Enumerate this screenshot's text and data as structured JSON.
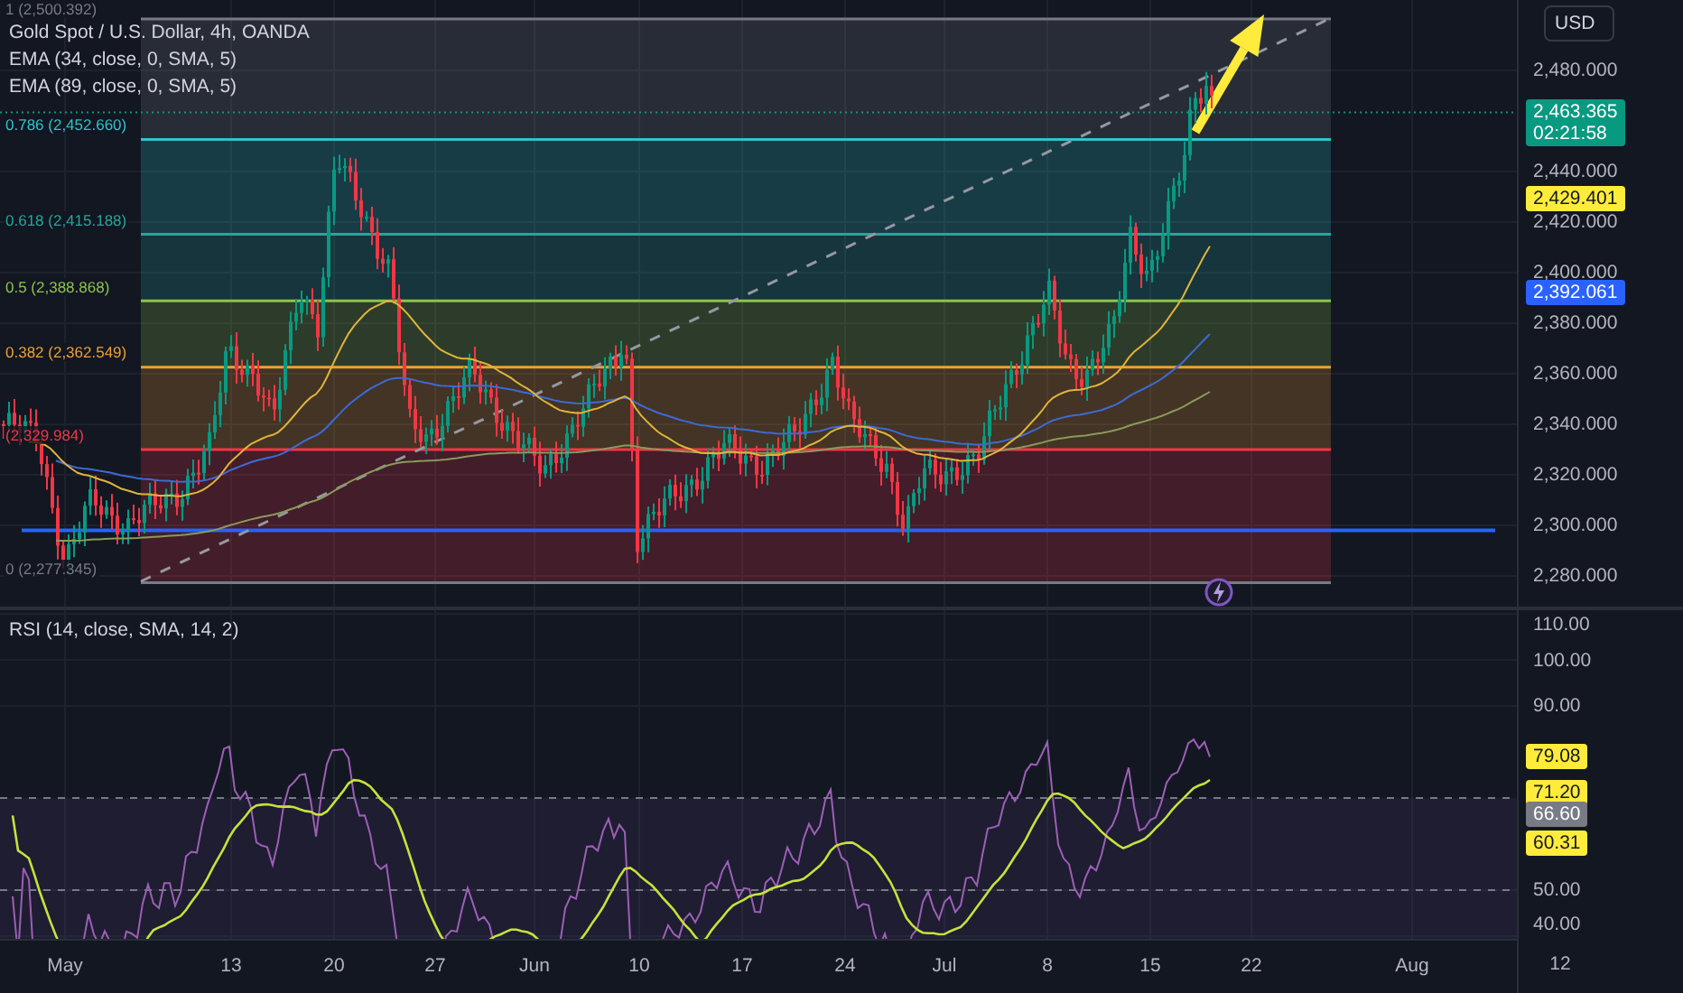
{
  "legend": {
    "title": "Gold Spot / U.S. Dollar, 4h, OANDA",
    "indicators": [
      "EMA (34, close, 0, SMA, 5)",
      "EMA (89, close, 0, SMA, 5)"
    ]
  },
  "currency_button": "USD",
  "fib_levels": [
    {
      "label": "1 (2,500.392)",
      "color": "#787b86"
    },
    {
      "label": "0.786 (2,452.660)",
      "color": "#2ec4c9"
    },
    {
      "label": "0.618 (2,415.188)",
      "color": "#26a69a"
    },
    {
      "label": "0.5 (2,388.868)",
      "color": "#8bc34a"
    },
    {
      "label": "0.382 (2,362.549)",
      "color": "#f0a030"
    },
    {
      "label": "(2,329.984)",
      "color": "#f23645"
    },
    {
      "label": "0 (2,277.345)",
      "color": "#787b86"
    }
  ],
  "price_axis": {
    "ticks": [
      "2,480.000",
      "2,440.000",
      "2,420.000",
      "2,400.000",
      "2,380.000",
      "2,360.000",
      "2,340.000",
      "2,320.000",
      "2,300.000",
      "2,280.000"
    ]
  },
  "price_tags": [
    {
      "value": "2,463.365",
      "countdown": "02:21:58",
      "color": "#089981"
    },
    {
      "value": "2,429.401",
      "color": "#ffeb3b"
    },
    {
      "value": "2,392.061",
      "color": "#2962ff"
    }
  ],
  "rsi_pane": {
    "title": "RSI (14, close, SMA, 14, 2)",
    "ticks": [
      "110.00",
      "100.00",
      "90.00",
      "50.00",
      "40.00"
    ],
    "tags": [
      {
        "value": "79.08",
        "color": "#ffeb3b"
      },
      {
        "value": "71.20",
        "color": "#ffeb3b"
      },
      {
        "value": "66.60",
        "color": "#787b86"
      },
      {
        "value": "60.31",
        "color": "#ffeb3b"
      }
    ]
  },
  "time_axis": [
    "May",
    "13",
    "20",
    "27",
    "Jun",
    "10",
    "17",
    "24",
    "Jul",
    "8",
    "15",
    "22",
    "Aug",
    "12"
  ]
}
